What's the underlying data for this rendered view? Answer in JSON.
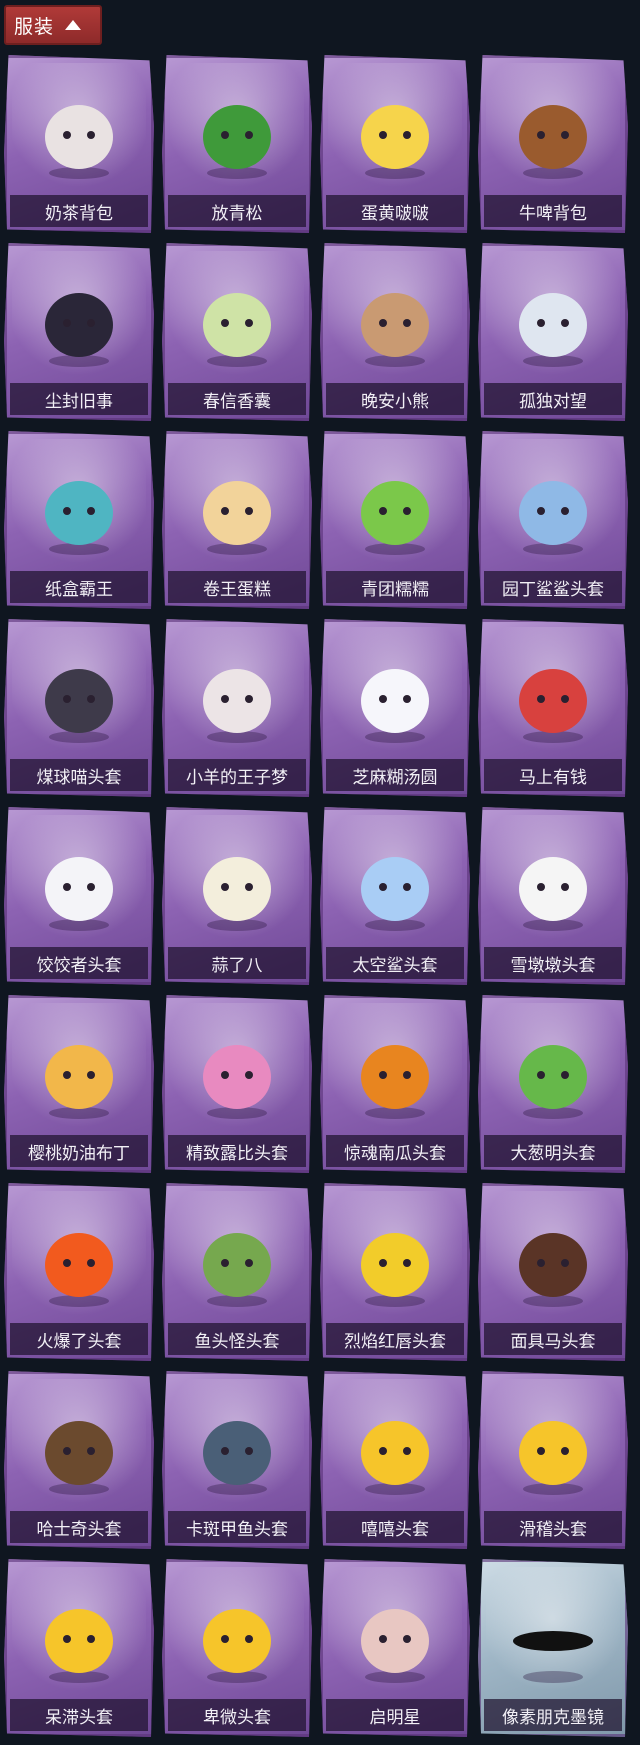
{
  "header": {
    "label": "服装"
  },
  "items": [
    {
      "label": "奶茶背包",
      "icon": "milk-tea-bag-icon",
      "color": "#e9e2e2"
    },
    {
      "label": "放青松",
      "icon": "bonsai-pine-icon",
      "color": "#3f9a3a"
    },
    {
      "label": "蛋黄啵啵",
      "icon": "egg-chick-icon",
      "color": "#f6d44b"
    },
    {
      "label": "牛啤背包",
      "icon": "cow-beer-barrel-icon",
      "color": "#9a5b2e"
    },
    {
      "label": "尘封旧事",
      "icon": "doll-keychain-icon",
      "color": "#2a2638"
    },
    {
      "label": "春信香囊",
      "icon": "sachet-icon",
      "color": "#cfe3a6"
    },
    {
      "label": "晚安小熊",
      "icon": "bear-keychain-icon",
      "color": "#c99a72"
    },
    {
      "label": "孤独对望",
      "icon": "figure-keychain-icon",
      "color": "#dfe6f0"
    },
    {
      "label": "纸盒霸王",
      "icon": "box-dino-icon",
      "color": "#4fb5c2"
    },
    {
      "label": "卷王蛋糕",
      "icon": "roll-cake-icon",
      "color": "#f2d39a"
    },
    {
      "label": "青团糯糯",
      "icon": "green-rice-ball-icon",
      "color": "#7bc84a"
    },
    {
      "label": "园丁鲨鲨头套",
      "icon": "shark-head-icon",
      "color": "#8fb9e6"
    },
    {
      "label": "煤球喵头套",
      "icon": "cat-head-icon",
      "color": "#3e3a4a"
    },
    {
      "label": "小羊的王子梦",
      "icon": "sheep-crown-icon",
      "color": "#ece4e6"
    },
    {
      "label": "芝麻糊汤圆",
      "icon": "dumpling-head-icon",
      "color": "#f6f6fb"
    },
    {
      "label": "马上有钱",
      "icon": "horse-head-icon",
      "color": "#d8413e"
    },
    {
      "label": "饺饺者头套",
      "icon": "cloud-dumpling-icon",
      "color": "#f4f4f8"
    },
    {
      "label": "蒜了八",
      "icon": "garlic-icon",
      "color": "#f3eedc"
    },
    {
      "label": "太空鲨头套",
      "icon": "space-shark-icon",
      "color": "#a9cdf5"
    },
    {
      "label": "雪墩墩头套",
      "icon": "snowman-head-icon",
      "color": "#f5f5f5"
    },
    {
      "label": "樱桃奶油布丁",
      "icon": "pudding-icon",
      "color": "#f2b74a"
    },
    {
      "label": "精致露比头套",
      "icon": "pink-bird-icon",
      "color": "#e88ac0"
    },
    {
      "label": "惊魂南瓜头套",
      "icon": "pumpkin-icon",
      "color": "#e8851f"
    },
    {
      "label": "大葱明头套",
      "icon": "scallion-icon",
      "color": "#66b84a"
    },
    {
      "label": "火爆了头套",
      "icon": "fire-head-icon",
      "color": "#f25a1e"
    },
    {
      "label": "鱼头怪头套",
      "icon": "fish-monster-icon",
      "color": "#76a84e"
    },
    {
      "label": "烈焰红唇头套",
      "icon": "pikachu-sunglasses-icon",
      "color": "#f2cc2a"
    },
    {
      "label": "面具马头套",
      "icon": "horse-mask-icon",
      "color": "#5a3426"
    },
    {
      "label": "哈士奇头套",
      "icon": "husky-sunglasses-icon",
      "color": "#6b4a2e"
    },
    {
      "label": "卡斑甲鱼头套",
      "icon": "fish-head-icon",
      "color": "#4a5f77"
    },
    {
      "label": "嘻嘻头套",
      "icon": "grin-emoji-icon",
      "color": "#f6c52a"
    },
    {
      "label": "滑稽头套",
      "icon": "funny-emoji-icon",
      "color": "#f6c52a"
    },
    {
      "label": "呆滞头套",
      "icon": "dazed-emoji-icon",
      "color": "#f6c52a"
    },
    {
      "label": "卑微头套",
      "icon": "humble-emoji-icon",
      "color": "#f6c52a"
    },
    {
      "label": "启明星",
      "icon": "bust-figure-icon",
      "color": "#e8c7c2"
    },
    {
      "label": "像素朋克墨镜",
      "icon": "pixel-sunglasses-icon",
      "color": "#111111",
      "special": true
    }
  ]
}
